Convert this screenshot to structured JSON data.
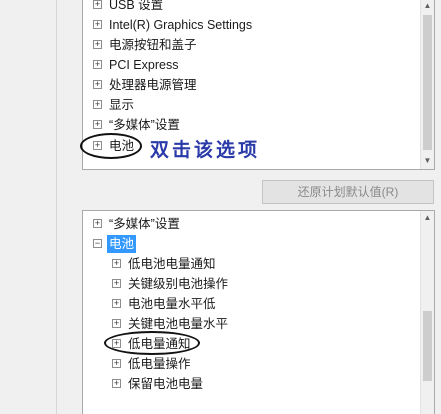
{
  "top_tree": {
    "items": [
      {
        "label": "USB 设置"
      },
      {
        "label": "Intel(R) Graphics Settings"
      },
      {
        "label": "电源按钮和盖子"
      },
      {
        "label": "PCI Express"
      },
      {
        "label": "处理器电源管理"
      },
      {
        "label": "显示"
      },
      {
        "label": "“多媒体”设置"
      },
      {
        "label": "电池"
      }
    ]
  },
  "annotation_text": "双击该选项",
  "restore_button": {
    "label": "还原计划默认值(R)"
  },
  "bottom_tree": {
    "items": [
      {
        "label": "“多媒体”设置",
        "expanded": false
      },
      {
        "label": "电池",
        "expanded": true,
        "selected": true
      },
      {
        "label": "低电池电量通知",
        "child": true
      },
      {
        "label": "关键级别电池操作",
        "child": true
      },
      {
        "label": "电池电量水平低",
        "child": true
      },
      {
        "label": "关键电池电量水平",
        "child": true
      },
      {
        "label": "低电量通知",
        "child": true
      },
      {
        "label": "低电量操作",
        "child": true
      },
      {
        "label": "保留电池电量",
        "child": true
      }
    ]
  },
  "icons": {
    "expand": "plus-box-icon",
    "collapse": "minus-box-icon",
    "scroll_up": "arrow-up-icon",
    "scroll_down": "arrow-down-icon"
  },
  "colors": {
    "selection": "#3399ff",
    "annotation": "#2a3aa8",
    "panel_border": "#a9a9a9"
  }
}
